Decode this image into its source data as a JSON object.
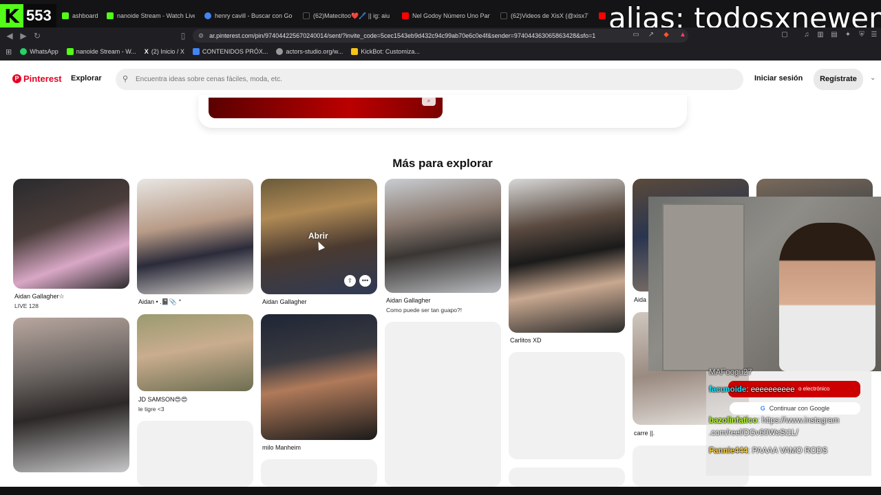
{
  "kick": {
    "count": "553"
  },
  "stream_overlay": {
    "alias": "alias: todosxnewen"
  },
  "tabs": [
    {
      "label": "ashboard",
      "color": "#53fc18"
    },
    {
      "label": "nanoide Stream - Watch Live o",
      "color": "#53fc18"
    },
    {
      "label": "henry cavill - Buscar con Goog",
      "color": "#4285f4"
    },
    {
      "label": "(62)Matecitoo❤️🖊️ || ig: aiu",
      "color": "#111111"
    },
    {
      "label": "Nel Godoy Número Uno Panif",
      "color": "#ff0000"
    },
    {
      "label": "(62)Videos de XisX (@xisx77) c",
      "color": "#111111"
    },
    {
      "label": "C",
      "color": "#ff0000"
    }
  ],
  "browser": {
    "url": "ar.pinterest.com/pin/974044225670240014/sent/?invite_code=5cec1543eb9d432c94c99ab70e6c0e4f&sender=974044363065863428&sfo=1",
    "bookmarks": [
      {
        "label": "WhatsApp",
        "color": "#25d366"
      },
      {
        "label": "nanoide Stream - W...",
        "color": "#53fc18"
      },
      {
        "label": "(2) Inicio / X",
        "color": "#ffffff"
      },
      {
        "label": "CONTENIDOS PRÓX...",
        "color": "#4285f4"
      },
      {
        "label": "actors-studio.org/w...",
        "color": "#999999"
      },
      {
        "label": "KickBot: Customiza...",
        "color": "#f5c518"
      }
    ]
  },
  "pinterest": {
    "logo": "Pinterest",
    "nav_explorar": "Explorar",
    "search_placeholder": "Encuentra ideas sobre cenas fáciles, moda, etc.",
    "login": "Iniciar sesión",
    "register": "Regístrate",
    "section_title": "Más para explorar",
    "hover_label": "Abrir",
    "captions": {
      "c1_title": "Aidan Gallagher☆",
      "c1_sub": "LIVE 128",
      "c2_title": "Aidan • .📓📎 °",
      "c3_title": "Aidan Gallagher",
      "c4_title": "Aidan Gallagher",
      "c4_sub": "Como puede ser tan guapo?!",
      "c5_title": "Carlitos XD",
      "c6_title": "Aida",
      "c7_title": "JD SAMSON😍😍",
      "c7_sub": "le tigre <3",
      "c8_title": "milo Manheim",
      "c9_title": "carre ||."
    }
  },
  "chat": {
    "top_user": "MAFoogu27",
    "red_banner_text": "o electrónico",
    "google_label": "Continuar con Google",
    "messages": [
      {
        "user": "facunoide",
        "user_color": "#19e6ff",
        "text": "eeeeeeeeee"
      },
      {
        "user": "bazolinfatico",
        "user_color": "#b7ff2a",
        "text": "https://www.instagram"
      },
      {
        "user": "",
        "user_color": "#ffffff",
        "text": ".com/reel/DGv60WsSt1L/"
      },
      {
        "user": "Fannie444",
        "user_color": "#ffd23f",
        "text": "PAAAA VAMO RODS"
      }
    ]
  }
}
